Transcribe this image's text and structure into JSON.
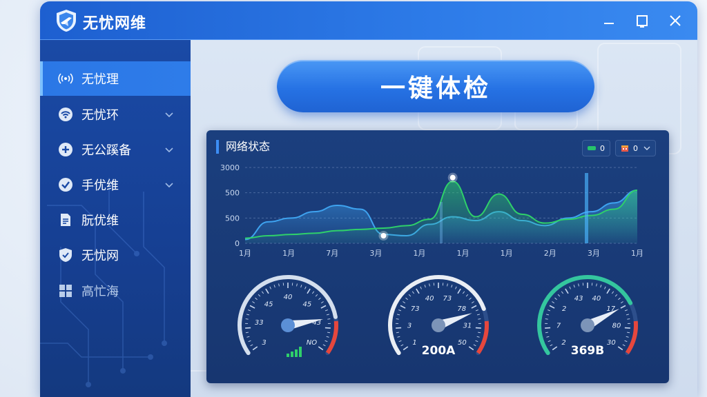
{
  "window": {
    "title": "无忧网维"
  },
  "sidebar": {
    "items": [
      {
        "label": "无忧理",
        "active": true
      },
      {
        "label": "无忧环",
        "expandable": true
      },
      {
        "label": "无公蹊备",
        "expandable": true
      },
      {
        "label": "手优维",
        "expandable": true
      },
      {
        "label": "朊优维"
      },
      {
        "label": "无忧网"
      },
      {
        "label": "高忙海",
        "dim": true
      }
    ]
  },
  "main": {
    "check_button": "一键体检",
    "panel": {
      "title": "网络状态",
      "legend": [
        {
          "value": "0",
          "color": "#27c46b"
        },
        {
          "value": "0",
          "has_dropdown": true
        }
      ]
    }
  },
  "chart_data": {
    "type": "area",
    "title": "网络状态",
    "y_ticks": [
      "3000",
      "500",
      "500",
      "0"
    ],
    "x_ticks": [
      "1月",
      "1月",
      "7月",
      "3月",
      "1月",
      "1月",
      "1月",
      "2月",
      "3月",
      "1月"
    ],
    "ylim": [
      0,
      3000
    ],
    "grid": true,
    "series": [
      {
        "color": "#3ea3f0",
        "values": [
          150,
          850,
          1000,
          1250,
          1500,
          1350,
          350,
          300,
          750,
          1050,
          900,
          1250,
          900,
          700,
          1000,
          1250,
          1600,
          2100
        ]
      },
      {
        "color": "#2fd06a",
        "values": [
          200,
          300,
          350,
          400,
          500,
          550,
          600,
          700,
          950,
          2450,
          1050,
          1950,
          1150,
          800,
          950,
          1100,
          1350,
          2100
        ]
      }
    ],
    "highlight_points": [
      {
        "x_index": 9,
        "value": 2600
      },
      {
        "x_index": 6,
        "value": 300
      }
    ]
  },
  "gauges": [
    {
      "ticks": [
        "3",
        "33",
        "45",
        "40",
        "45",
        "43",
        "NO"
      ],
      "value_fraction": 0.82,
      "has_bars": true,
      "colors": {
        "progress": "#e7eef8",
        "danger": "#e5473d"
      }
    },
    {
      "ticks": [
        "1",
        "3",
        "73",
        "40",
        "73",
        "78",
        "31",
        "50"
      ],
      "readout": "200A",
      "value_fraction": 0.78,
      "colors": {
        "progress": "#ffffff",
        "danger": "#e5473d"
      }
    },
    {
      "ticks": [
        "2",
        "7",
        "2",
        "43",
        "40",
        "17",
        "80",
        "30"
      ],
      "readout": "369B",
      "value_fraction": 0.75,
      "colors": {
        "progress": "#35d3a0",
        "danger": "#e5473d"
      }
    }
  ],
  "colors": {
    "accent": "#2d7be8",
    "sidebar": "#1a4aa6",
    "panel": "#1b3f7e",
    "green": "#2fd06a"
  }
}
